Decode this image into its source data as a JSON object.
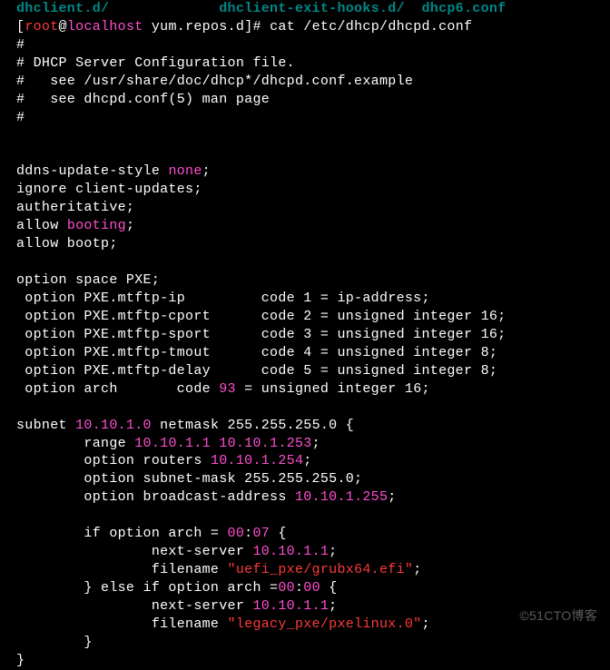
{
  "prompt": {
    "top_partial": "dhclient.d/             dhclient-exit-hooks.d/  dhcp6.conf",
    "user": "root",
    "at": "@",
    "host": "localhost",
    "path": " yum.repos.d",
    "bracket_close": "]# ",
    "command": "cat /etc/dhcp/dhcpd.conf"
  },
  "header": {
    "l1": "#",
    "l2": "# DHCP Server Configuration file.",
    "l3": "#   see /usr/share/doc/dhcp*/dhcpd.conf.example",
    "l4": "#   see dhcpd.conf(5) man page",
    "l5": "#"
  },
  "ddns": {
    "l1a": "ddns-update-style ",
    "l1b": "none",
    "l1c": ";",
    "l2": "ignore client-updates;",
    "l3": "autheritative;",
    "l4a": "allow ",
    "l4b": "booting",
    "l4c": ";",
    "l5": "allow bootp;"
  },
  "options": {
    "l1": "option space PXE;",
    "l2": " option PXE.mtftp-ip         code 1 = ip-address;",
    "l3": " option PXE.mtftp-cport      code 2 = unsigned integer 16;",
    "l4": " option PXE.mtftp-sport      code 3 = unsigned integer 16;",
    "l5": " option PXE.mtftp-tmout      code 4 = unsigned integer 8;",
    "l6": " option PXE.mtftp-delay      code 5 = unsigned integer 8;",
    "l7a": " option arch       code ",
    "l7b": "93",
    "l7c": " = unsigned integer 16;"
  },
  "subnet": {
    "l1a": "subnet ",
    "l1b": "10.10.1.0",
    "l1c": " netmask 255.255.255.0 {",
    "l2a": "        range ",
    "l2b": "10.10.1.1",
    "l2c": " ",
    "l2d": "10.10.1.253",
    "l2e": ";",
    "l3a": "        option routers ",
    "l3b": "10.10.1.254",
    "l3c": ";",
    "l4": "        option subnet-mask 255.255.255.0;",
    "l5a": "        option broadcast-address ",
    "l5b": "10.10.1.255",
    "l5c": ";",
    "l6a": "        if option arch = ",
    "l6b": "00",
    "l6c": ":",
    "l6d": "07",
    "l6e": " {",
    "l7a": "                next-server ",
    "l7b": "10.10.1.1",
    "l7c": ";",
    "l8a": "                filename ",
    "l8b": "\"uefi_pxe/grubx64.efi\"",
    "l8c": ";",
    "l9a": "        } else if option arch =",
    "l9b": "00",
    "l9c": ":",
    "l9d": "00",
    "l9e": " {",
    "l10a": "                next-server ",
    "l10b": "10.10.1.1",
    "l10c": ";",
    "l11a": "                filename ",
    "l11b": "\"legacy_pxe/pxelinux.0\"",
    "l11c": ";",
    "l12": "        }",
    "l13": "}"
  },
  "watermark": "©51CTO博客"
}
